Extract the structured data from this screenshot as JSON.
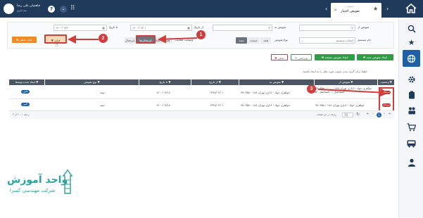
{
  "topbar": {
    "tab_small": "عمومی",
    "tab_title": "تفویض اختیار",
    "user_name": "چاهمیان علی رضا",
    "user_role": "نیم اداری"
  },
  "filters": {
    "delegator_label": "تفویض از",
    "delegatee_label": "تفویض به",
    "from_date_label": "از تاریخ",
    "to_date_label": "تا تاریخ",
    "from_date_value": "۱۴۰۰/۰۷/۰۱",
    "to_date_value": "۱۴۰۰/۰۷/۲۰",
    "system_label": "نام سیستم",
    "system_value": "انتخاب سیستم",
    "type_label": "نوع تفویض",
    "type_options": [
      "همه",
      "صفحه",
      "سند"
    ],
    "status_label": "وضعیت فعالیت",
    "status_options": [
      "همه",
      "فعال",
      "غیرفعال"
    ],
    "filter_button": "فیلتر",
    "clear_filter_button": "حذف فیلتر",
    "active_status_chip": "غیرفعال‌ها"
  },
  "actions": {
    "create_document": "ایجاد تفویض سند",
    "create_page": "ایجاد تفویض صفحه",
    "edit": "ویرایش",
    "delete": "حذف"
  },
  "hint": "لطفا برای گروه بندی ستون مورد نظر را به اینجا بکشید",
  "table": {
    "headers": [
      "وضعیت",
      "تفویض از",
      "تفویض به",
      "از تاریخ",
      "تا تاریخ",
      "نوع تفویض",
      "ایجاد شده توسط"
    ],
    "rows": [
      {
        "status": "غیرفعال",
        "from": "۹۷۰۳۵۸ - جواهری جواد - اداری تهران ۱۸۸ - ... - اسماعیل ... اسماعیل ۵۰",
        "to": "۹۷۰۳۵۸ - جواهری جواد - اداری تهران ۱۸۸",
        "start": "۱۳۹۸/۰۴/۰۱",
        "end": "۱۴۰۰/۰۷/۱۸",
        "type": "سند",
        "creator": "قانون"
      },
      {
        "status": "غیرفعال",
        "from": "۹۷۰۳۵۸ - جواهری جواد - اداری تهران ۱۸۸",
        "to": "۹۷۰۳۵۸ - جواهری جواد - اداری تهران ۱۸۸",
        "start": "۱۳۹۸/۰۴/۰۱",
        "end": "۱۴۰۰/۰۷/۱۸",
        "type": "سند",
        "creator": "قانون"
      }
    ]
  },
  "pagination": {
    "current_page": "1",
    "page_size": "10",
    "page_size_label": "ردیف در هر صفحه",
    "summary": "ردیف ۱ - ۲ از ۲"
  },
  "callouts": [
    "1",
    "2",
    "3"
  ],
  "watermark": {
    "title": "واحد آموزش",
    "subtitle": "شرکت مهندسی کسرا"
  },
  "colors": {
    "topbar": "#1f3a5a",
    "accent_orange": "#f08a24",
    "green": "#2e9d4a",
    "red": "#d33c3c",
    "callout": "#d33c3c",
    "header_gray": "#4b5563",
    "watermark": "#2aa39a"
  }
}
